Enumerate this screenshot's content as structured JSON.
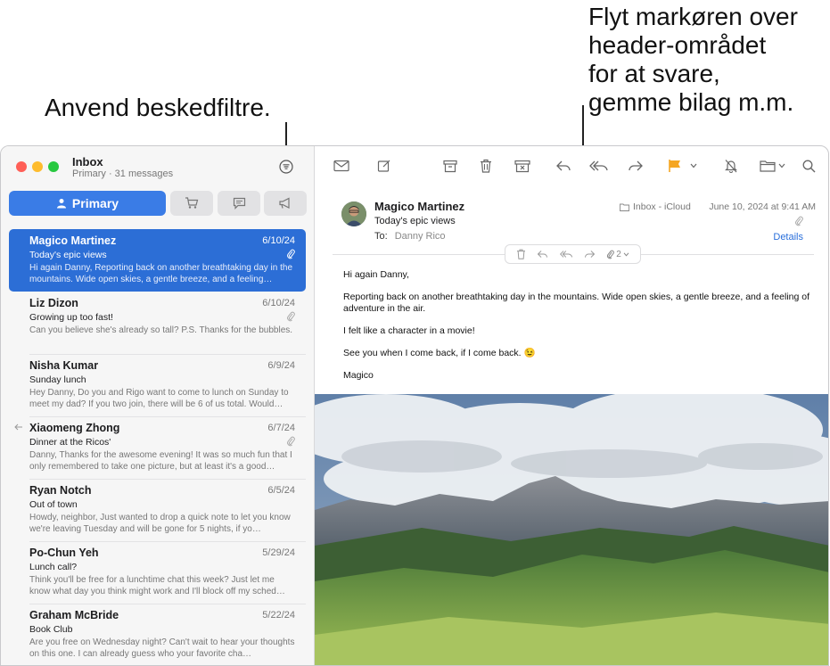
{
  "callouts": {
    "left": "Anvend beskedfiltre.",
    "right_line1": "Flyt markøren over",
    "right_line2": "header-området",
    "right_line3": "for at svare,",
    "right_line4": "gemme bilag m.m."
  },
  "sidebar": {
    "title": "Inbox",
    "subtitle": "Primary · 31 messages",
    "primary_tab": "Primary",
    "messages": [
      {
        "sender": "Magico Martinez",
        "date": "6/10/24",
        "subject": "Today's epic views",
        "preview": "Hi again Danny, Reporting back on another breathtaking day in the mountains. Wide open skies, a gentle breeze, and a feeling…"
      },
      {
        "sender": "Liz Dizon",
        "date": "6/10/24",
        "subject": "Growing up too fast!",
        "preview": "Can you believe she's already so tall? P.S. Thanks for the bubbles."
      },
      {
        "sender": "Nisha Kumar",
        "date": "6/9/24",
        "subject": "Sunday lunch",
        "preview": "Hey Danny, Do you and Rigo want to come to lunch on Sunday to meet my dad? If you two join, there will be 6 of us total. Would…"
      },
      {
        "sender": "Xiaomeng Zhong",
        "date": "6/7/24",
        "subject": "Dinner at the Ricos'",
        "preview": "Danny, Thanks for the awesome evening! It was so much fun that I only remembered to take one picture, but at least it's a good…"
      },
      {
        "sender": "Ryan Notch",
        "date": "6/5/24",
        "subject": "Out of town",
        "preview": "Howdy, neighbor, Just wanted to drop a quick note to let you know we're leaving Tuesday and will be gone for 5 nights, if yo…"
      },
      {
        "sender": "Po-Chun Yeh",
        "date": "5/29/24",
        "subject": "Lunch call?",
        "preview": "Think you'll be free for a lunchtime chat this week? Just let me know what day you think might work and I'll block off my sched…"
      },
      {
        "sender": "Graham McBride",
        "date": "5/22/24",
        "subject": "Book Club",
        "preview": "Are you free on Wednesday night? Can't wait to hear your thoughts on this one. I can already guess who your favorite cha…"
      }
    ]
  },
  "message": {
    "sender": "Magico Martinez",
    "subject": "Today's epic views",
    "to_label": "To:",
    "to_name": "Danny Rico",
    "mailbox": "Inbox - iCloud",
    "date": "June 10, 2024 at 9:41 AM",
    "details": "Details",
    "attachment_count": "2",
    "body": [
      "Hi again Danny,",
      "Reporting back on another breathtaking day in the mountains. Wide open skies, a gentle breeze, and a feeling of adventure in the air.",
      "I felt like a character in a movie!",
      "See you when I come back, if I come back. 😉",
      "Magico"
    ]
  },
  "colors": {
    "accent": "#3a7ce6",
    "selected_row": "#2c6ed6",
    "flag": "#f5a623",
    "link": "#2a6fdb"
  },
  "icons": [
    "filter-icon",
    "compose-icon",
    "archive-icon",
    "trash-icon",
    "junk-icon",
    "reply-icon",
    "reply-all-icon",
    "forward-icon",
    "flag-icon",
    "mute-icon",
    "move-icon",
    "search-icon",
    "paperclip-icon",
    "shopping-cart-icon",
    "chat-icon",
    "megaphone-icon",
    "person-icon",
    "folder-icon"
  ]
}
